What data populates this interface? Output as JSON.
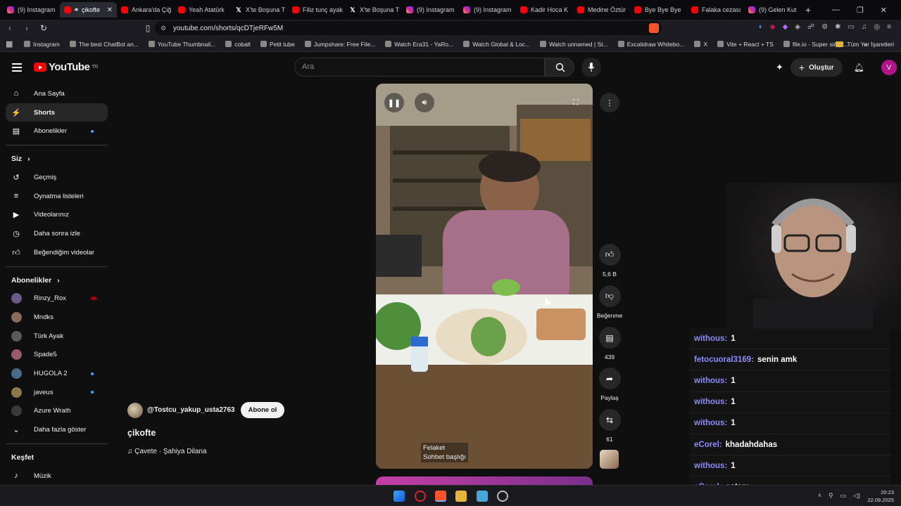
{
  "browser": {
    "tabs": [
      {
        "label": "(9) Instagram",
        "icon": "instagram-icon",
        "kind": "ig"
      },
      {
        "label": "çikofte",
        "icon": "youtube-icon",
        "kind": "yt",
        "active": true
      },
      {
        "label": "Ankara'da Çiğ",
        "icon": "youtube-icon",
        "kind": "yt"
      },
      {
        "label": "Yeah Atatürk",
        "icon": "youtube-icon",
        "kind": "yt"
      },
      {
        "label": "X'te Boşuna T",
        "icon": "x-icon",
        "kind": "x"
      },
      {
        "label": "Filiz tunç ayak",
        "icon": "youtube-icon",
        "kind": "yt"
      },
      {
        "label": "X'te Boşuna T",
        "icon": "x-icon",
        "kind": "x"
      },
      {
        "label": "(9) Instagram",
        "icon": "instagram-icon",
        "kind": "ig"
      },
      {
        "label": "(9) Instagram",
        "icon": "instagram-icon",
        "kind": "ig"
      },
      {
        "label": "Kadir Hoca K",
        "icon": "youtube-icon",
        "kind": "yt"
      },
      {
        "label": "Medine Öztür",
        "icon": "youtube-icon",
        "kind": "yt"
      },
      {
        "label": "Bye Bye Bye",
        "icon": "youtube-icon",
        "kind": "yt"
      },
      {
        "label": "Falaka cezası",
        "icon": "youtube-icon",
        "kind": "yt"
      },
      {
        "label": "(9) Gelen Kut",
        "icon": "instagram-icon",
        "kind": "ig"
      }
    ],
    "url": "youtube.com/shorts/qcDTjeRFw5M",
    "bookmarks": [
      "Instagram",
      "The best ChatBot an...",
      "YouTube Thumbnail...",
      "cobalt",
      "Petit tube",
      "Jumpshare: Free File...",
      "Watch Era31 - YaRo...",
      "Watch Global & Loc...",
      "Watch unnamed | St...",
      "Excalidraw Whitebo...",
      "X",
      "Vite + React + TS",
      "file.io - Super simpl..."
    ],
    "bookmarks_folder": "Tüm Yer İşaretleri"
  },
  "youtube": {
    "logo_text": "YouTube",
    "logo_sup": "TR",
    "search_placeholder": "Ara",
    "create_label": "Oluştur",
    "avatar_letter": "V",
    "sidebar": {
      "main": [
        {
          "label": "Ana Sayfa",
          "icon": "home-icon"
        },
        {
          "label": "Shorts",
          "icon": "shorts-icon",
          "active": true
        },
        {
          "label": "Abonelikler",
          "icon": "subscriptions-icon",
          "dot": true
        }
      ],
      "you_header": "Siz",
      "you": [
        {
          "label": "Geçmiş",
          "icon": "history-icon"
        },
        {
          "label": "Oynatma listeleri",
          "icon": "playlist-icon"
        },
        {
          "label": "Videolarınız",
          "icon": "your-videos-icon"
        },
        {
          "label": "Daha sonra izle",
          "icon": "watch-later-icon"
        },
        {
          "label": "Beğendiğim videolar",
          "icon": "liked-icon"
        }
      ],
      "subs_header": "Abonelikler",
      "subs": [
        {
          "label": "Rinzy_Rox",
          "color": "#6a5a8a",
          "live": true
        },
        {
          "label": "Mndks",
          "color": "#8a6a5a"
        },
        {
          "label": "Türk Ayak",
          "color": "#5a5a5a"
        },
        {
          "label": "Spade5",
          "color": "#9a5a6a"
        },
        {
          "label": "HUGOLA 2",
          "color": "#4a6a8a",
          "dot": true
        },
        {
          "label": "javeus",
          "color": "#8a7a4a",
          "dot": true
        },
        {
          "label": "Azure Wrath",
          "color": "#3a3a3a"
        }
      ],
      "show_more": "Daha fazla göster",
      "explore_header": "Keşfet",
      "explore_first": "Müzik"
    },
    "short": {
      "channel": "@Tostcu_yakup_usta2763",
      "subscribe": "Abone ol",
      "title": "çikofte",
      "music": "♫ Çavete · Şahiya Dilana",
      "overlay_line1": "Felaket",
      "overlay_line2": "Sohbet başlığı",
      "likes": "5,6 B",
      "dislike_label": "Beğenme",
      "comments": "439",
      "share_label": "Paylaş",
      "remix": "61"
    }
  },
  "chat": [
    {
      "user": "withous:",
      "text": "1"
    },
    {
      "user": "fetocuoral3169:",
      "text": "senin amk"
    },
    {
      "user": "withous:",
      "text": "1"
    },
    {
      "user": "withous:",
      "text": "1"
    },
    {
      "user": "withous:",
      "text": "1"
    },
    {
      "user": "eCorel:",
      "text": "khadahdahas"
    },
    {
      "user": "withous:",
      "text": "1"
    },
    {
      "user": "eCorel:",
      "text": "ostam"
    }
  ],
  "taskbar": {
    "time": "20:23",
    "date": "22.09.2025"
  }
}
